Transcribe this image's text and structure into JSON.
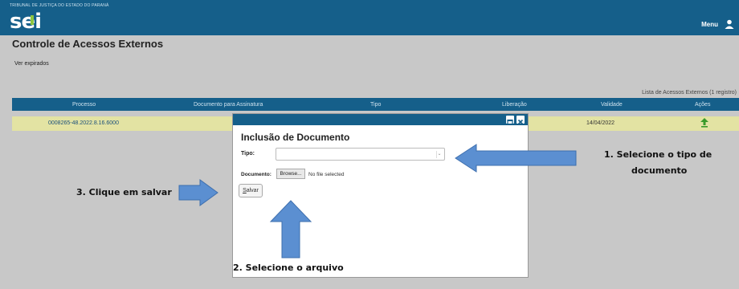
{
  "header": {
    "court_name": "TRIBUNAL DE JUSTIÇA DO ESTADO DO PARANÁ",
    "logo": "sei",
    "menu_label": "Menu",
    "user_icon": "user-icon",
    "brand_color": "#155f8a",
    "accent_color": "#8dc63f"
  },
  "page": {
    "title": "Controle de Acessos Externos",
    "ver_expirados": "Ver expirados"
  },
  "table": {
    "caption": "Lista de Acessos Externos (1 registro)",
    "columns": [
      "Processo",
      "Documento para Assinatura",
      "Tipo",
      "Liberação",
      "Validade",
      "Ações"
    ],
    "rows": [
      {
        "processo": "0008265-48.2022.8.16.6000",
        "documento": "",
        "tipo": "",
        "liberacao": "",
        "validade": "14/04/2022",
        "acao_icon": "upload-arrow-icon"
      }
    ],
    "row_highlight_color": "#e3e3a3"
  },
  "dialog": {
    "title": "Inclusão de Documento",
    "tipo_label": "Tipo:",
    "tipo_value": "",
    "documento_label": "Documento:",
    "browse_label": "Browse...",
    "no_file_text": "No file selected",
    "save_label": "Salvar",
    "save_label_rest": "alvar",
    "save_label_first": "S"
  },
  "annotations": {
    "step1_line1": "1. Selecione o tipo de",
    "step1_line2": "documento",
    "step2": "2. Selecione o arquivo",
    "step3": "3. Clique em salvar",
    "arrow_color": "#5b8fd1"
  }
}
